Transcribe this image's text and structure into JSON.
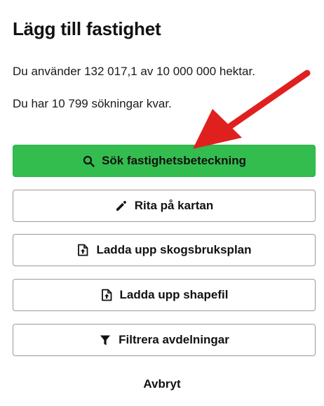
{
  "dialog": {
    "title": "Lägg till fastighet",
    "usage_text": "Du använder 132 017,1 av 10 000 000 hektar.",
    "searches_text": "Du har 10 799 sökningar kvar."
  },
  "buttons": [
    {
      "label": "Sök fastighetsbeteckning",
      "icon": "search-icon",
      "style": "primary"
    },
    {
      "label": "Rita på kartan",
      "icon": "pencil-icon",
      "style": "outline"
    },
    {
      "label": "Ladda upp skogsbruksplan",
      "icon": "file-upload-icon",
      "style": "outline"
    },
    {
      "label": "Ladda upp shapefil",
      "icon": "file-upload-icon",
      "style": "outline"
    },
    {
      "label": "Filtrera avdelningar",
      "icon": "filter-icon",
      "style": "outline"
    }
  ],
  "cancel_label": "Avbryt",
  "colors": {
    "primary": "#33bd4f",
    "annotation_arrow": "#e0201f"
  }
}
